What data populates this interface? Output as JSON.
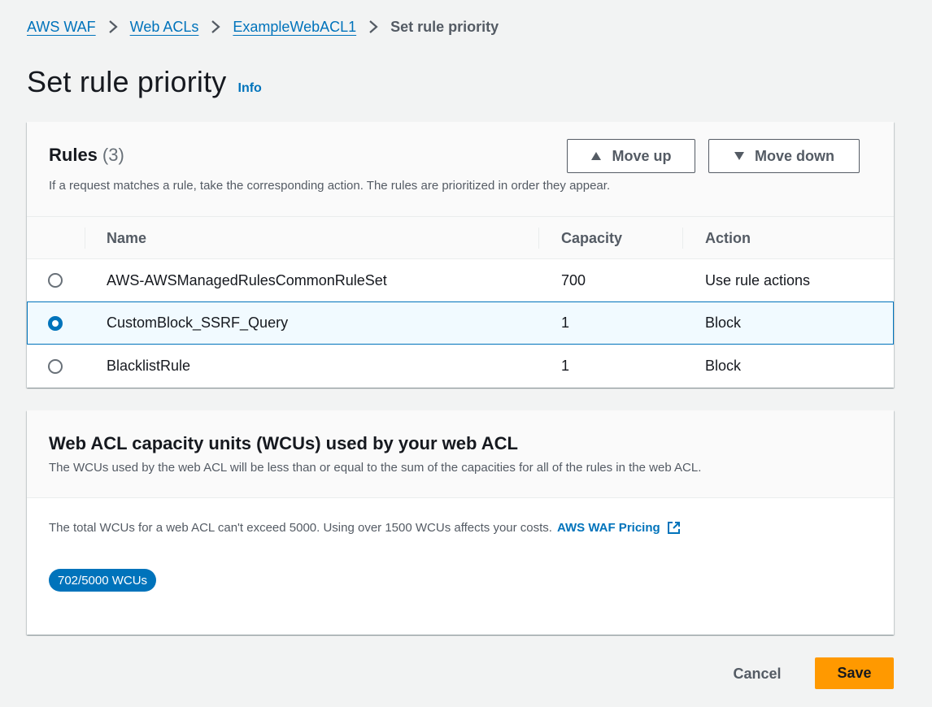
{
  "breadcrumb": {
    "items": [
      "AWS WAF",
      "Web ACLs",
      "ExampleWebACL1"
    ],
    "current": "Set rule priority"
  },
  "page": {
    "title": "Set rule priority",
    "info": "Info"
  },
  "rules": {
    "title": "Rules",
    "count": "(3)",
    "description": "If a request matches a rule, take the corresponding action. The rules are prioritized in order they appear.",
    "move_up": "Move up",
    "move_down": "Move down",
    "columns": [
      "Name",
      "Capacity",
      "Action"
    ],
    "rows": [
      {
        "name": "AWS-AWSManagedRulesCommonRuleSet",
        "capacity": "700",
        "action": "Use rule actions",
        "selected": false
      },
      {
        "name": "CustomBlock_SSRF_Query",
        "capacity": "1",
        "action": "Block",
        "selected": true
      },
      {
        "name": "BlacklistRule",
        "capacity": "1",
        "action": "Block",
        "selected": false
      }
    ]
  },
  "wcu": {
    "title": "Web ACL capacity units (WCUs) used by your web ACL",
    "description": "The WCUs used by the web ACL will be less than or equal to the sum of the capacities for all of the rules in the web ACL.",
    "note": "The total WCUs for a web ACL can't exceed 5000. Using over 1500 WCUs affects your costs.",
    "pricing_link": "AWS WAF Pricing",
    "badge": "702/5000 WCUs"
  },
  "footer": {
    "cancel": "Cancel",
    "save": "Save"
  },
  "icons": {
    "separator": "chevron-right-icon",
    "move_up": "triangle-up-icon",
    "move_down": "triangle-down-icon",
    "external": "external-link-icon"
  },
  "colors": {
    "link": "#0073bb",
    "primary_button": "#ff9900",
    "selected_row_bg": "#f1faff",
    "badge": "#0073bb"
  }
}
